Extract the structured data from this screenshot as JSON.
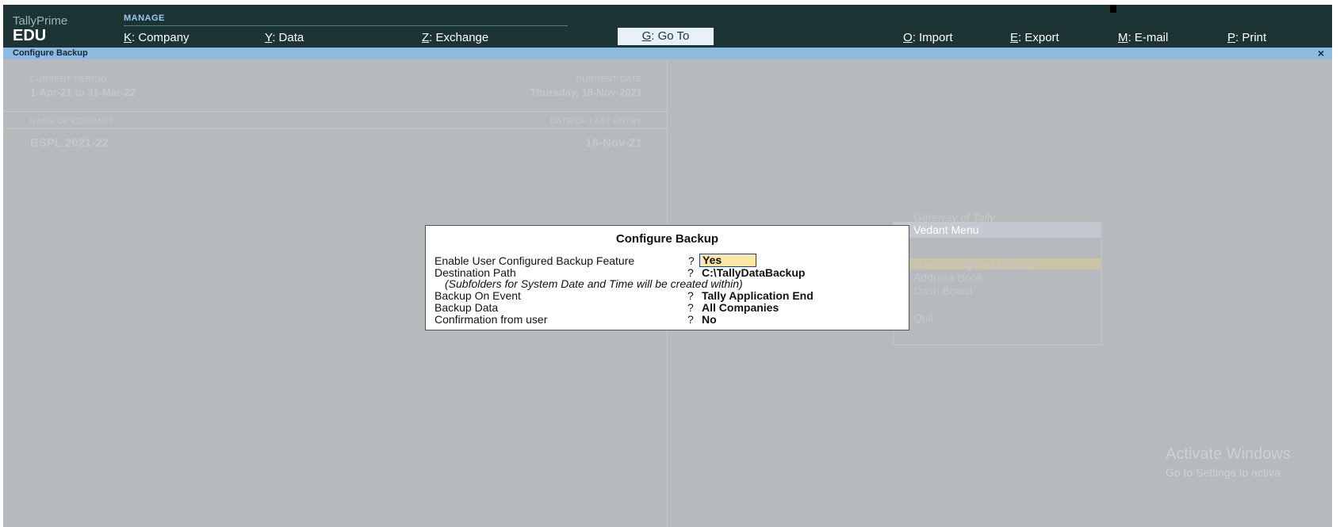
{
  "brand": {
    "app": "TallyPrime",
    "edition": "EDU"
  },
  "topmenu": {
    "section": "MANAGE",
    "company": {
      "key": "K",
      "label": ": Company"
    },
    "data": {
      "key": "Y",
      "label": ": Data"
    },
    "exchange": {
      "key": "Z",
      "label": ": Exchange"
    },
    "goto": {
      "key": "G",
      "label": ": Go To"
    },
    "import": {
      "key": "O",
      "label": ": Import"
    },
    "export": {
      "key": "E",
      "label": ": Export"
    },
    "email": {
      "key": "M",
      "label": ": E-mail"
    },
    "print": {
      "key": "P",
      "label": ": Print"
    }
  },
  "window": {
    "title": "Configure Backup",
    "close": "×"
  },
  "info": {
    "current_period_label": "CURRENT PERIOD",
    "current_period": "1-Apr-21 to 31-Mar-22",
    "current_date_label": "CURRENT DATE",
    "current_date": "Thursday, 18-Nov-2021",
    "company_label": "NAME OF COMPANY",
    "last_entry_label": "DATE OF LAST ENTRY",
    "company": "BSPL 2021-22",
    "last_entry": "18-Nov-21"
  },
  "gateway": {
    "title": "Gateway of Tally",
    "menu_title": "Vedant Menu",
    "items": [
      "User Configured Backup",
      "Address Book",
      "Dash Board",
      "Quit"
    ]
  },
  "dialog": {
    "title": "Configure Backup",
    "enable_label": "Enable User Configured Backup Feature",
    "enable_value": "Yes",
    "dest_label": "Destination Path",
    "dest_value": "C:\\TallyDataBackup",
    "note": "(Subfolders for System Date and Time will be created within)",
    "event_label": "Backup On Event",
    "event_value": "Tally Application End",
    "data_label": "Backup Data",
    "data_value": "All Companies",
    "confirm_label": "Confirmation from user",
    "confirm_value": "No",
    "q": "?"
  },
  "watermark": {
    "line1": "Activate Windows",
    "line2": "Go to Settings to activa"
  },
  "colors": {
    "topbar": "#1d3434",
    "titlebar": "#8fbbe0",
    "background": "#b6babd",
    "field": "#fde8a8"
  }
}
